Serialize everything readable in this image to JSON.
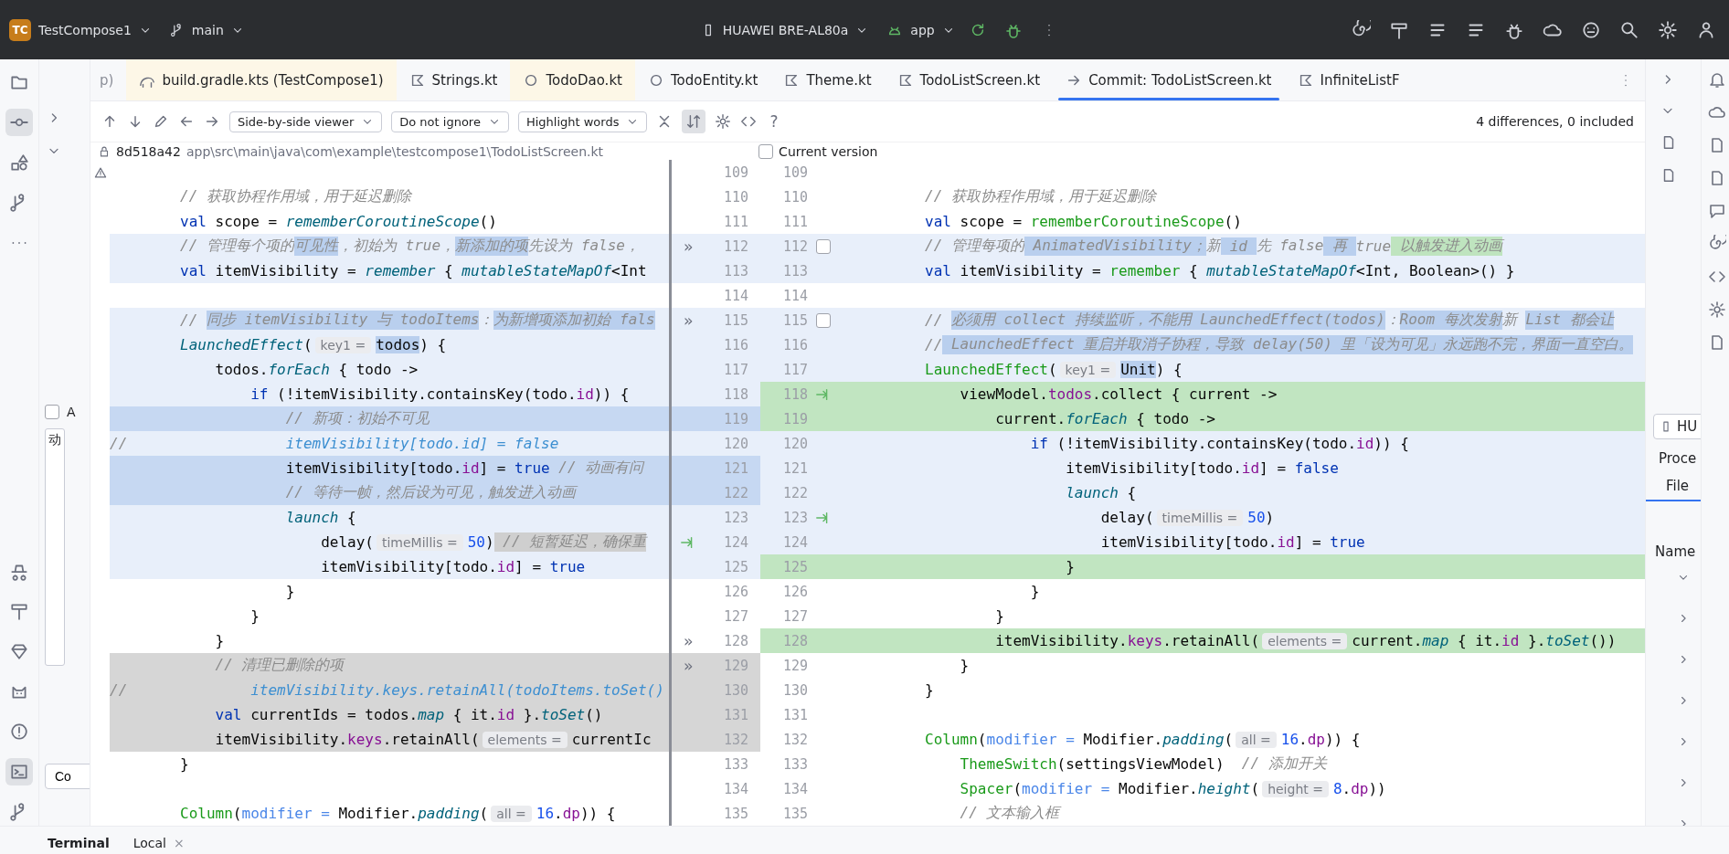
{
  "top_bar": {
    "project_badge": "TC",
    "project": "TestCompose1",
    "branch": "main",
    "device": "HUAWEI BRE-AL80a",
    "config": "app"
  },
  "activity_bar": {
    "top": [
      {
        "kind": "folder",
        "selected": false
      },
      {
        "kind": "commit",
        "selected": true
      },
      {
        "kind": "shapes",
        "selected": false
      },
      {
        "kind": "branch",
        "selected": false
      },
      {
        "kind": "more",
        "selected": false
      }
    ],
    "bottom": [
      {
        "kind": "hat",
        "selected": false
      },
      {
        "kind": "hammer",
        "selected": false
      },
      {
        "kind": "gem",
        "selected": false
      },
      {
        "kind": "cat",
        "selected": false
      },
      {
        "kind": "alert",
        "selected": false
      },
      {
        "kind": "terminal",
        "selected": true
      },
      {
        "kind": "branch",
        "selected": false
      }
    ]
  },
  "tabs": [
    {
      "label": "p)",
      "selected": false,
      "tinted": false,
      "kind": "partial"
    },
    {
      "label": "build.gradle.kts (TestCompose1)",
      "selected": false,
      "tinted": true,
      "kind": "gradle"
    },
    {
      "label": "Strings.kt",
      "selected": false,
      "tinted": false,
      "kind": "kotlin"
    },
    {
      "label": "TodoDao.kt",
      "selected": false,
      "tinted": true,
      "kind": "interface"
    },
    {
      "label": "TodoEntity.kt",
      "selected": false,
      "tinted": false,
      "kind": "class"
    },
    {
      "label": "Theme.kt",
      "selected": false,
      "tinted": false,
      "kind": "kotlin"
    },
    {
      "label": "TodoListScreen.kt",
      "selected": false,
      "tinted": false,
      "kind": "kotlin"
    },
    {
      "label": "Commit: TodoListScreen.kt",
      "selected": true,
      "tinted": false,
      "kind": "diff"
    },
    {
      "label": "InfiniteListF",
      "selected": false,
      "tinted": false,
      "kind": "kotlin"
    }
  ],
  "toolbar": {
    "viewer": "Side-by-side viewer",
    "ignore": "Do not ignore",
    "highlight": "Highlight words",
    "sync_scroll": true,
    "help": "?",
    "summary": "4 differences, 0 included"
  },
  "path_bar": {
    "revision": "8d518a42",
    "path": "app\\src\\main\\java\\com\\example\\testcompose1\\TodoListScreen.kt",
    "current_version": {
      "label": "Current version",
      "checked": false
    }
  },
  "left_panel": {
    "checkbox": {
      "label": "A",
      "checked": false
    },
    "list_item": "动",
    "button": "Co"
  },
  "rows": [
    {
      "left": {
        "number": "109"
      },
      "right": {
        "number": "109"
      }
    },
    {
      "left": {
        "number": "110",
        "kind": "unchanged",
        "segments": [
          {
            "kind": "comment",
            "text": "        // 获取协程作用域，用于延迟删除"
          }
        ]
      },
      "right": {
        "number": "110",
        "kind": "unchanged",
        "segments": [
          {
            "kind": "comment",
            "text": "        // 获取协程作用域，用于延迟删除"
          }
        ]
      }
    },
    {
      "left": {
        "number": "111",
        "kind": "unchanged",
        "segments": [
          {
            "kind": "keyword",
            "text": "        val"
          },
          {
            "kind": "plain",
            "text": " scope = "
          },
          {
            "kind": "function",
            "text": "rememberCoroutineScope"
          },
          {
            "kind": "plain",
            "text": "()"
          }
        ]
      },
      "right": {
        "number": "111",
        "kind": "unchanged",
        "segments": [
          {
            "kind": "keyword",
            "text": "        val"
          },
          {
            "kind": "plain",
            "text": " scope = "
          },
          {
            "kind": "call",
            "text": "rememberCoroutineScope"
          },
          {
            "kind": "plain",
            "text": "()"
          }
        ]
      }
    },
    {
      "left": {
        "number": "112",
        "kind": "changed",
        "mark": {
          "kind": "apply",
          "text": "»"
        },
        "segments": [
          {
            "kind": "comment",
            "text": "        // 管理每个项的"
          },
          {
            "kind": "comment",
            "text": "可见性",
            "highlighted": true
          },
          {
            "kind": "comment",
            "text": "，初始为 true，"
          },
          {
            "kind": "comment",
            "text": "新添加的项",
            "highlighted": true
          },
          {
            "kind": "comment",
            "text": "先设为 false，"
          }
        ]
      },
      "right": {
        "number": "112",
        "kind": "changed",
        "mark": {
          "kind": "checkbox",
          "checked": false
        },
        "segments": [
          {
            "kind": "comment",
            "text": "        // 管理每项的"
          },
          {
            "kind": "comment",
            "text": " AnimatedVisibility；",
            "highlighted": true
          },
          {
            "kind": "comment",
            "text": "新"
          },
          {
            "kind": "comment",
            "text": " id ",
            "highlighted": true
          },
          {
            "kind": "comment",
            "text": "先 false"
          },
          {
            "kind": "comment",
            "text": " 再 ",
            "highlighted": true
          },
          {
            "kind": "comment",
            "text": "true"
          },
          {
            "kind": "comment",
            "text": " 以触发进入动画",
            "added": true
          }
        ]
      }
    },
    {
      "left": {
        "number": "113",
        "kind": "changed",
        "segments": [
          {
            "kind": "keyword",
            "text": "        val"
          },
          {
            "kind": "plain",
            "text": " itemVisibility = "
          },
          {
            "kind": "function",
            "text": "remember"
          },
          {
            "kind": "plain",
            "text": " { "
          },
          {
            "kind": "function",
            "text": "mutableStateMapOf"
          },
          {
            "kind": "plain",
            "text": "<Int"
          }
        ]
      },
      "right": {
        "number": "113",
        "kind": "changed",
        "segments": [
          {
            "kind": "keyword",
            "text": "        val"
          },
          {
            "kind": "plain",
            "text": " itemVisibility = "
          },
          {
            "kind": "call",
            "text": "remember"
          },
          {
            "kind": "plain",
            "text": " { "
          },
          {
            "kind": "function",
            "text": "mutableStateMapOf"
          },
          {
            "kind": "plain",
            "text": "<Int, Boolean>() }"
          }
        ]
      }
    },
    {
      "left": {
        "number": "114"
      },
      "right": {
        "number": "114"
      }
    },
    {
      "left": {
        "number": "115",
        "kind": "changed",
        "mark": {
          "kind": "apply",
          "text": "»"
        },
        "segments": [
          {
            "kind": "comment",
            "text": "        // "
          },
          {
            "kind": "comment",
            "text": "同步 itemVisibility 与 todoItems",
            "highlighted": true
          },
          {
            "kind": "comment",
            "text": "："
          },
          {
            "kind": "comment",
            "text": "为新增项添加初始 fals",
            "highlighted": true
          }
        ]
      },
      "right": {
        "number": "115",
        "kind": "changed",
        "mark": {
          "kind": "checkbox",
          "checked": false
        },
        "segments": [
          {
            "kind": "comment",
            "text": "        // "
          },
          {
            "kind": "comment",
            "text": "必须用 collect 持续监听，不能用 LaunchedEffect(todos)",
            "highlighted": true
          },
          {
            "kind": "comment",
            "text": "："
          },
          {
            "kind": "comment",
            "text": "Room 每次发射",
            "highlighted": true
          },
          {
            "kind": "comment",
            "text": "新 "
          },
          {
            "kind": "comment",
            "text": "List 都会让",
            "highlighted": true
          }
        ]
      }
    },
    {
      "left": {
        "number": "116",
        "kind": "changed",
        "segments": [
          {
            "kind": "function",
            "text": "        LaunchedEffect"
          },
          {
            "kind": "plain",
            "text": "("
          },
          {
            "kind": "hint",
            "text": "key1 ="
          },
          {
            "kind": "plain",
            "text": "todos",
            "highlighted": true
          },
          {
            "kind": "plain",
            "text": ") {"
          }
        ]
      },
      "right": {
        "number": "116",
        "kind": "changed",
        "segments": [
          {
            "kind": "comment",
            "text": "        //"
          },
          {
            "kind": "comment",
            "text": " LaunchedEffect 重启并取消子协程，导致 delay(50) 里「设为可见」永远跑不完，界面一直空白。",
            "highlighted": true
          }
        ]
      }
    },
    {
      "left": {
        "number": "117",
        "kind": "changed",
        "segments": [
          {
            "kind": "plain",
            "text": "            todos."
          },
          {
            "kind": "function",
            "text": "forEach"
          },
          {
            "kind": "plain",
            "text": " { todo ->"
          }
        ]
      },
      "right": {
        "number": "117",
        "kind": "changed",
        "segments": [
          {
            "kind": "call",
            "text": "        LaunchedEffect"
          },
          {
            "kind": "plain",
            "text": "("
          },
          {
            "kind": "hint",
            "text": "key1 ="
          },
          {
            "kind": "plain",
            "text": "Unit",
            "highlighted": true
          },
          {
            "kind": "plain",
            "text": ") {"
          }
        ]
      }
    },
    {
      "left": {
        "number": "118",
        "kind": "changed",
        "segments": [
          {
            "kind": "keyword",
            "text": "                if"
          },
          {
            "kind": "plain",
            "text": " (!itemVisibility.containsKey(todo."
          },
          {
            "kind": "property",
            "text": "id"
          },
          {
            "kind": "plain",
            "text": ")) {"
          }
        ]
      },
      "right": {
        "number": "118",
        "kind": "added",
        "mark": {
          "kind": "arrow"
        },
        "segments": [
          {
            "kind": "plain",
            "text": "            viewModel."
          },
          {
            "kind": "property",
            "text": "todos"
          },
          {
            "kind": "plain",
            "text": ".collect { current ->"
          }
        ]
      }
    },
    {
      "left": {
        "number": "119",
        "kind": "changed",
        "highlighted": true,
        "segments": [
          {
            "kind": "comment",
            "text": "                    // 新项：初始不可见"
          }
        ]
      },
      "right": {
        "number": "119",
        "kind": "added",
        "segments": [
          {
            "kind": "plain",
            "text": "                current."
          },
          {
            "kind": "function",
            "text": "forEach"
          },
          {
            "kind": "plain",
            "text": " { todo ->"
          }
        ]
      }
    },
    {
      "left": {
        "number": "120",
        "kind": "changed",
        "segments": [
          {
            "kind": "comment",
            "text": "//"
          },
          {
            "kind": "disabled",
            "text": "                  itemVisibility[todo.id] = false"
          }
        ]
      },
      "right": {
        "number": "120",
        "kind": "changed",
        "segments": [
          {
            "kind": "keyword",
            "text": "                    if"
          },
          {
            "kind": "plain",
            "text": " (!itemVisibility.containsKey(todo."
          },
          {
            "kind": "property",
            "text": "id"
          },
          {
            "kind": "plain",
            "text": ")) {"
          }
        ]
      }
    },
    {
      "left": {
        "number": "121",
        "kind": "changed",
        "highlighted": true,
        "segments": [
          {
            "kind": "plain",
            "text": "                    itemVisibility[todo."
          },
          {
            "kind": "property",
            "text": "id"
          },
          {
            "kind": "plain",
            "text": "] = "
          },
          {
            "kind": "keyword",
            "text": "true"
          },
          {
            "kind": "comment",
            "text": " // 动画有问"
          }
        ]
      },
      "right": {
        "number": "121",
        "kind": "changed",
        "segments": [
          {
            "kind": "plain",
            "text": "                        itemVisibility[todo."
          },
          {
            "kind": "property",
            "text": "id"
          },
          {
            "kind": "plain",
            "text": "] = "
          },
          {
            "kind": "keyword",
            "text": "false"
          }
        ]
      }
    },
    {
      "left": {
        "number": "122",
        "kind": "changed",
        "highlighted": true,
        "segments": [
          {
            "kind": "comment",
            "text": "                    // 等待一帧，然后设为可见，触发进入动画"
          }
        ]
      },
      "right": {
        "number": "122",
        "kind": "changed",
        "segments": [
          {
            "kind": "function",
            "text": "                        launch"
          },
          {
            "kind": "plain",
            "text": " {"
          }
        ]
      }
    },
    {
      "left": {
        "number": "123",
        "kind": "changed",
        "segments": [
          {
            "kind": "function",
            "text": "                    launch"
          },
          {
            "kind": "plain",
            "text": " {"
          }
        ]
      },
      "right": {
        "number": "123",
        "kind": "changed",
        "mark": {
          "kind": "arrow"
        },
        "segments": [
          {
            "kind": "plain",
            "text": "                            delay("
          },
          {
            "kind": "hint",
            "text": "timeMillis ="
          },
          {
            "kind": "number",
            "text": "50"
          },
          {
            "kind": "plain",
            "text": ")"
          }
        ]
      }
    },
    {
      "left": {
        "number": "124",
        "kind": "changed",
        "mark": {
          "kind": "arrow"
        },
        "segments": [
          {
            "kind": "plain",
            "text": "                        delay("
          },
          {
            "kind": "hint",
            "text": "timeMillis ="
          },
          {
            "kind": "number",
            "text": "50"
          },
          {
            "kind": "plain",
            "text": ")"
          },
          {
            "kind": "comment",
            "text": " // 短暂延迟，确保重",
            "removed": true
          }
        ]
      },
      "right": {
        "number": "124",
        "kind": "changed",
        "segments": [
          {
            "kind": "plain",
            "text": "                            itemVisibility[todo."
          },
          {
            "kind": "property",
            "text": "id"
          },
          {
            "kind": "plain",
            "text": "] = "
          },
          {
            "kind": "keyword",
            "text": "true"
          }
        ]
      }
    },
    {
      "left": {
        "number": "125",
        "kind": "changed",
        "segments": [
          {
            "kind": "plain",
            "text": "                        itemVisibility[todo."
          },
          {
            "kind": "property",
            "text": "id"
          },
          {
            "kind": "plain",
            "text": "] = "
          },
          {
            "kind": "keyword",
            "text": "true"
          }
        ]
      },
      "right": {
        "number": "125",
        "kind": "added",
        "segments": [
          {
            "kind": "plain",
            "text": "                        }"
          }
        ]
      }
    },
    {
      "left": {
        "number": "126",
        "kind": "unchanged",
        "segments": [
          {
            "kind": "plain",
            "text": "                    }"
          }
        ]
      },
      "right": {
        "number": "126",
        "kind": "unchanged",
        "segments": [
          {
            "kind": "plain",
            "text": "                    }"
          }
        ]
      }
    },
    {
      "left": {
        "number": "127",
        "kind": "unchanged",
        "segments": [
          {
            "kind": "plain",
            "text": "                }"
          }
        ]
      },
      "right": {
        "number": "127",
        "kind": "unchanged",
        "segments": [
          {
            "kind": "plain",
            "text": "                }"
          }
        ]
      }
    },
    {
      "left": {
        "number": "128",
        "kind": "unchanged",
        "mark": {
          "kind": "apply",
          "text": "»"
        },
        "segments": [
          {
            "kind": "plain",
            "text": "            }"
          }
        ]
      },
      "right": {
        "number": "128",
        "kind": "added",
        "segments": [
          {
            "kind": "plain",
            "text": "                itemVisibility."
          },
          {
            "kind": "property",
            "text": "keys"
          },
          {
            "kind": "plain",
            "text": ".retainAll("
          },
          {
            "kind": "hint",
            "text": "elements ="
          },
          {
            "kind": "plain",
            "text": "current."
          },
          {
            "kind": "function",
            "text": "map"
          },
          {
            "kind": "plain",
            "text": " { it."
          },
          {
            "kind": "property",
            "text": "id"
          },
          {
            "kind": "plain",
            "text": " }."
          },
          {
            "kind": "function",
            "text": "toSet"
          },
          {
            "kind": "plain",
            "text": "())"
          }
        ]
      }
    },
    {
      "left": {
        "number": "129",
        "kind": "deleted",
        "mark": {
          "kind": "apply",
          "text": "»"
        },
        "segments": [
          {
            "kind": "comment",
            "text": "            // 清理已删除的项"
          }
        ]
      },
      "right": {
        "number": "129",
        "kind": "unchanged",
        "segments": [
          {
            "kind": "plain",
            "text": "            }"
          }
        ]
      }
    },
    {
      "left": {
        "number": "130",
        "kind": "deleted",
        "segments": [
          {
            "kind": "comment",
            "text": "//"
          },
          {
            "kind": "disabled",
            "text": "              itemVisibility.keys.retainAll(todoItems.toSet()"
          }
        ]
      },
      "right": {
        "number": "130",
        "kind": "unchanged",
        "segments": [
          {
            "kind": "plain",
            "text": "        }"
          }
        ]
      }
    },
    {
      "left": {
        "number": "131",
        "kind": "deleted",
        "segments": [
          {
            "kind": "keyword",
            "text": "            val"
          },
          {
            "kind": "plain",
            "text": " currentIds = todos."
          },
          {
            "kind": "function",
            "text": "map"
          },
          {
            "kind": "plain",
            "text": " { it."
          },
          {
            "kind": "property",
            "text": "id"
          },
          {
            "kind": "plain",
            "text": " }."
          },
          {
            "kind": "function",
            "text": "toSet"
          },
          {
            "kind": "plain",
            "text": "()"
          }
        ]
      },
      "right": {
        "number": "131"
      }
    },
    {
      "left": {
        "number": "132",
        "kind": "deleted",
        "segments": [
          {
            "kind": "plain",
            "text": "            itemVisibility."
          },
          {
            "kind": "property",
            "text": "keys"
          },
          {
            "kind": "plain",
            "text": ".retainAll("
          },
          {
            "kind": "hint",
            "text": "elements ="
          },
          {
            "kind": "plain",
            "text": "currentIc"
          }
        ]
      },
      "right": {
        "number": "132",
        "kind": "unchanged",
        "segments": [
          {
            "kind": "call",
            "text": "        Column"
          },
          {
            "kind": "plain",
            "text": "("
          },
          {
            "kind": "param",
            "text": "modifier ="
          },
          {
            "kind": "plain",
            "text": " Modifier."
          },
          {
            "kind": "function",
            "text": "padding"
          },
          {
            "kind": "plain",
            "text": "("
          },
          {
            "kind": "hint",
            "text": "all ="
          },
          {
            "kind": "number",
            "text": "16"
          },
          {
            "kind": "plain",
            "text": "."
          },
          {
            "kind": "property",
            "text": "dp"
          },
          {
            "kind": "plain",
            "text": ")) {"
          }
        ]
      }
    },
    {
      "left": {
        "number": "133",
        "kind": "unchanged",
        "segments": [
          {
            "kind": "plain",
            "text": "        }"
          }
        ]
      },
      "right": {
        "number": "133",
        "kind": "unchanged",
        "segments": [
          {
            "kind": "call",
            "text": "            ThemeSwitch"
          },
          {
            "kind": "plain",
            "text": "(settingsViewModel)  "
          },
          {
            "kind": "comment",
            "text": "// 添加开关"
          }
        ]
      }
    },
    {
      "left": {
        "number": "134"
      },
      "right": {
        "number": "134",
        "kind": "unchanged",
        "segments": [
          {
            "kind": "call",
            "text": "            Spacer"
          },
          {
            "kind": "plain",
            "text": "("
          },
          {
            "kind": "param",
            "text": "modifier ="
          },
          {
            "kind": "plain",
            "text": " Modifier."
          },
          {
            "kind": "function",
            "text": "height"
          },
          {
            "kind": "plain",
            "text": "("
          },
          {
            "kind": "hint",
            "text": "height ="
          },
          {
            "kind": "number",
            "text": "8"
          },
          {
            "kind": "plain",
            "text": "."
          },
          {
            "kind": "property",
            "text": "dp"
          },
          {
            "kind": "plain",
            "text": "))"
          }
        ]
      }
    },
    {
      "left": {
        "number": "135",
        "kind": "unchanged",
        "segments": [
          {
            "kind": "call",
            "text": "        Column"
          },
          {
            "kind": "plain",
            "text": "("
          },
          {
            "kind": "param",
            "text": "modifier ="
          },
          {
            "kind": "plain",
            "text": " Modifier."
          },
          {
            "kind": "function",
            "text": "padding"
          },
          {
            "kind": "plain",
            "text": "("
          },
          {
            "kind": "hint",
            "text": "all ="
          },
          {
            "kind": "number",
            "text": "16"
          },
          {
            "kind": "plain",
            "text": "."
          },
          {
            "kind": "property",
            "text": "dp"
          },
          {
            "kind": "plain",
            "text": ")) {"
          }
        ]
      },
      "right": {
        "number": "135",
        "kind": "unchanged",
        "segments": [
          {
            "kind": "comment",
            "text": "            // 文本输入框"
          }
        ]
      }
    }
  ],
  "right_panel": {
    "device": "HU",
    "tab": "Proce",
    "file_tab": "File",
    "column": "Name"
  },
  "bottom_panel": {
    "tabs": [
      {
        "label": "Terminal",
        "selected": true
      },
      {
        "label": "Local",
        "selected": false,
        "close": "×"
      }
    ]
  }
}
